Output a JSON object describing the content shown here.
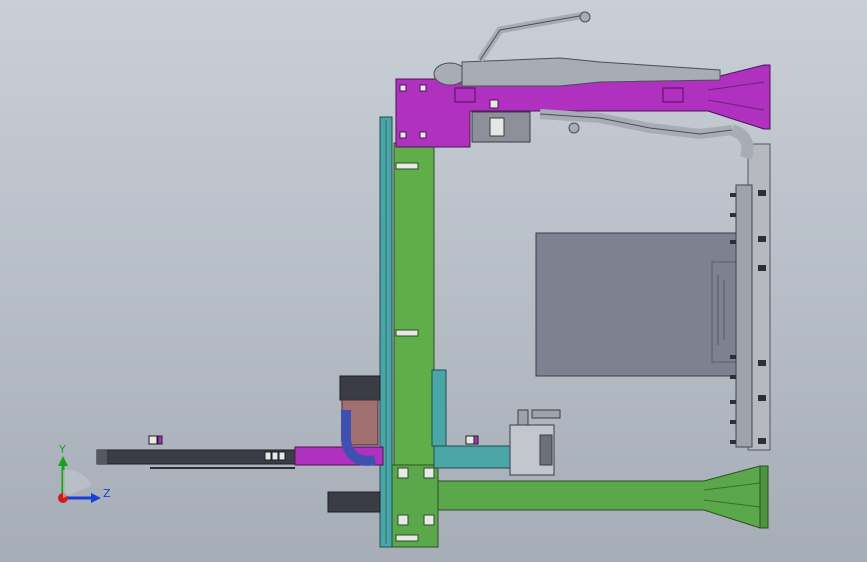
{
  "viewport": {
    "background_top": "#c9cfd6",
    "background_bottom": "#a6adb7"
  },
  "colors": {
    "column_green": "#5fae4a",
    "base_green": "#5aa84a",
    "beam_magenta": "#b030c0",
    "rail_teal": "#4aa6a6",
    "panel_gray": "#7d8190",
    "dark_metal": "#3a3d45",
    "mannequin_gray": "#a8adb5"
  },
  "triad": {
    "y_label": "Y",
    "z_label": "Z",
    "y_icon": "axis-y-arrow-icon",
    "z_icon": "axis-z-arrow-icon",
    "x_icon": "axis-x-origin-icon",
    "y_color": "#1aa31a",
    "z_color": "#1a3fd6",
    "x_color": "#d11a1a"
  }
}
